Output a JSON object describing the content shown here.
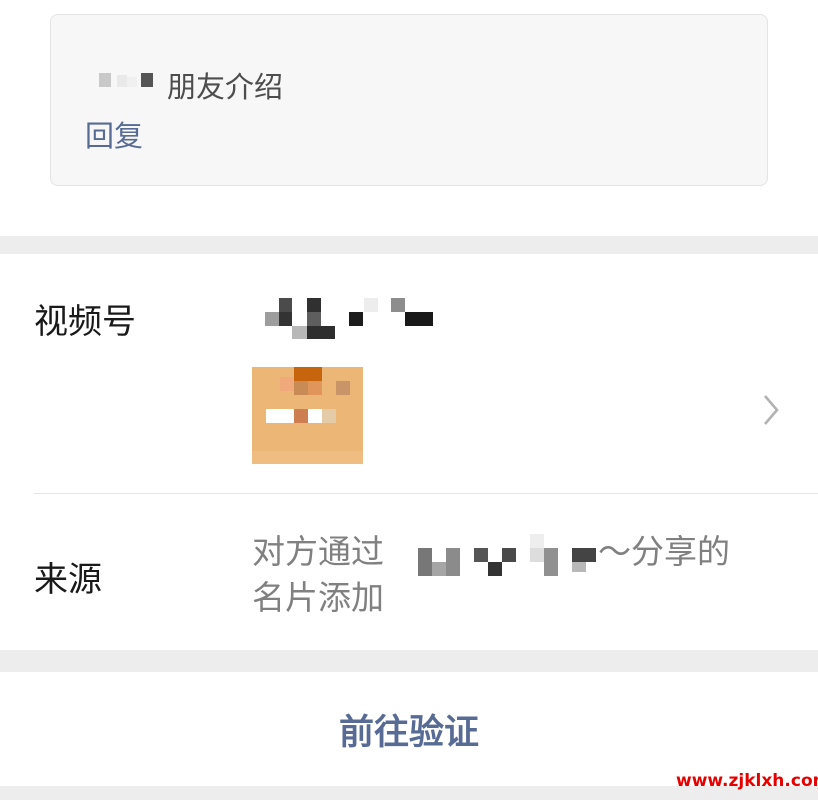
{
  "friend_request": {
    "message": "朋友介绍",
    "reply_label": "回复"
  },
  "profile": {
    "channels_label": "视频号",
    "source_label": "来源",
    "source_text_line1a": "对方通过",
    "source_text_line1b": "～分享的",
    "source_text_line2": "名片添加"
  },
  "actions": {
    "verify_label": "前往验证"
  },
  "watermark": "www.zjklxh.com",
  "colors": {
    "link": "#576b95",
    "gap": "#ededed",
    "watermark": "#e60000"
  },
  "icons": {
    "chevron": "chevron-right-icon"
  }
}
